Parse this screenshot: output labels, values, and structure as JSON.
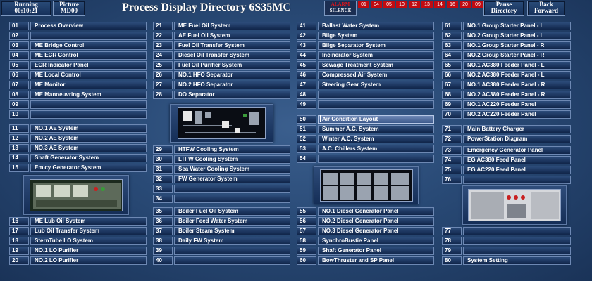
{
  "header": {
    "running_label": "Running",
    "running_time": "00:10:21",
    "picture_label": "Picture",
    "picture_id": "MD00",
    "title": "Process Display Directory 6S35MC",
    "alarm_label": "ALARM",
    "silence_label": "SILENCE",
    "alarm_codes": [
      "01",
      "04",
      "05",
      "10",
      "12",
      "13",
      "14",
      "16",
      "20",
      "09"
    ],
    "pause_label": "Pause",
    "directory_label": "Directory",
    "back_label": "Back",
    "forward_label": "Forward"
  },
  "col1": [
    {
      "num": "01",
      "label": "Process Overview"
    },
    {
      "num": "02",
      "label": ""
    },
    {
      "num": "03",
      "label": "ME Bridge Control"
    },
    {
      "num": "04",
      "label": "ME ECR Control"
    },
    {
      "num": "05",
      "label": "ECR Indicator Panel"
    },
    {
      "num": "06",
      "label": "ME Local Control"
    },
    {
      "num": "07",
      "label": "ME Monitor"
    },
    {
      "num": "08",
      "label": "ME Manoeuvring System"
    },
    {
      "num": "09",
      "label": ""
    },
    {
      "num": "10",
      "label": ""
    },
    {
      "num": "11",
      "label": "NO.1 AE System"
    },
    {
      "num": "12",
      "label": "NO.2 AE System"
    },
    {
      "num": "13",
      "label": "NO.3 AE System"
    },
    {
      "num": "14",
      "label": "Shaft Generator System"
    },
    {
      "num": "15",
      "label": "Em'cy Generator System"
    },
    {
      "num": "16",
      "label": "ME Lub Oil System"
    },
    {
      "num": "17",
      "label": "Lub Oil Transfer System"
    },
    {
      "num": "18",
      "label": "SternTube LO System"
    },
    {
      "num": "19",
      "label": "NO.1 LO Purifier"
    },
    {
      "num": "20",
      "label": "NO.2 LO Purifier"
    }
  ],
  "col2": [
    {
      "num": "21",
      "label": "ME Fuel Oil System"
    },
    {
      "num": "22",
      "label": "AE Fuel Oil System"
    },
    {
      "num": "23",
      "label": "Fuel Oil Transfer System"
    },
    {
      "num": "24",
      "label": "Diesel Oil Transfer System"
    },
    {
      "num": "25",
      "label": "Fuel Oil Purifier System"
    },
    {
      "num": "26",
      "label": "NO.1 HFO Separator"
    },
    {
      "num": "27",
      "label": "NO.2 HFO Separator"
    },
    {
      "num": "28",
      "label": "DO Separator"
    },
    {
      "num": "29",
      "label": "HTFW Cooling System"
    },
    {
      "num": "30",
      "label": "LTFW Cooling System"
    },
    {
      "num": "31",
      "label": "Sea Water Cooling System"
    },
    {
      "num": "32",
      "label": "FW Generator System"
    },
    {
      "num": "33",
      "label": ""
    },
    {
      "num": "34",
      "label": ""
    },
    {
      "num": "35",
      "label": "Boiler Fuel Oil System"
    },
    {
      "num": "36",
      "label": "Boiler Feed Water System"
    },
    {
      "num": "37",
      "label": "Boiler Steam System"
    },
    {
      "num": "38",
      "label": "Daily FW System"
    },
    {
      "num": "39",
      "label": ""
    },
    {
      "num": "40",
      "label": ""
    }
  ],
  "col3": [
    {
      "num": "41",
      "label": "Ballast Water System"
    },
    {
      "num": "42",
      "label": "Bilge System"
    },
    {
      "num": "43",
      "label": "Bilge Separator System"
    },
    {
      "num": "44",
      "label": "Incinerator System"
    },
    {
      "num": "45",
      "label": "Sewage Treatment System"
    },
    {
      "num": "46",
      "label": "Compressed Air System"
    },
    {
      "num": "47",
      "label": "Steering Gear System"
    },
    {
      "num": "48",
      "label": ""
    },
    {
      "num": "49",
      "label": ""
    },
    {
      "num": "50",
      "label": "Air Condition Layout"
    },
    {
      "num": "51",
      "label": "Summer A.C. System"
    },
    {
      "num": "52",
      "label": "Winter A.C. System"
    },
    {
      "num": "53",
      "label": "A.C. Chillers System"
    },
    {
      "num": "54",
      "label": ""
    },
    {
      "num": "55",
      "label": "NO.1 Diesel Generator Panel"
    },
    {
      "num": "56",
      "label": "NO.2 Diesel Generator Panel"
    },
    {
      "num": "57",
      "label": "NO.3 Diesel Generator Panel"
    },
    {
      "num": "58",
      "label": "SynchroBustie Panel"
    },
    {
      "num": "59",
      "label": "Shaft Generator Panel"
    },
    {
      "num": "60",
      "label": "BowThruster and SP Panel"
    }
  ],
  "col4": [
    {
      "num": "61",
      "label": "NO.1 Group Starter Panel - L"
    },
    {
      "num": "62",
      "label": "NO.2 Group Starter Panel - L"
    },
    {
      "num": "63",
      "label": "NO.1 Group Starter Panel - R"
    },
    {
      "num": "64",
      "label": "NO.2 Group Starter Panel - R"
    },
    {
      "num": "65",
      "label": "NO.1 AC380 Feeder Panel - L"
    },
    {
      "num": "66",
      "label": "NO.2 AC380 Feeder Panel - L"
    },
    {
      "num": "67",
      "label": "NO.1 AC380 Feeder Panel - R"
    },
    {
      "num": "68",
      "label": "NO.2 AC380 Feeder Panel - R"
    },
    {
      "num": "69",
      "label": "NO.1 AC220 Feeder Panel"
    },
    {
      "num": "70",
      "label": "NO.2 AC220 Feeder Panel"
    },
    {
      "num": "71",
      "label": "Main Battery Charger"
    },
    {
      "num": "72",
      "label": "PowerStation Diagram"
    },
    {
      "num": "73",
      "label": "Emergency Generator Panel"
    },
    {
      "num": "74",
      "label": "EG AC380 Feed Panel"
    },
    {
      "num": "75",
      "label": "EG AC220 Feed Panel"
    },
    {
      "num": "76",
      "label": ""
    },
    {
      "num": "77",
      "label": ""
    },
    {
      "num": "78",
      "label": ""
    },
    {
      "num": "79",
      "label": ""
    },
    {
      "num": "80",
      "label": "System Setting"
    }
  ]
}
